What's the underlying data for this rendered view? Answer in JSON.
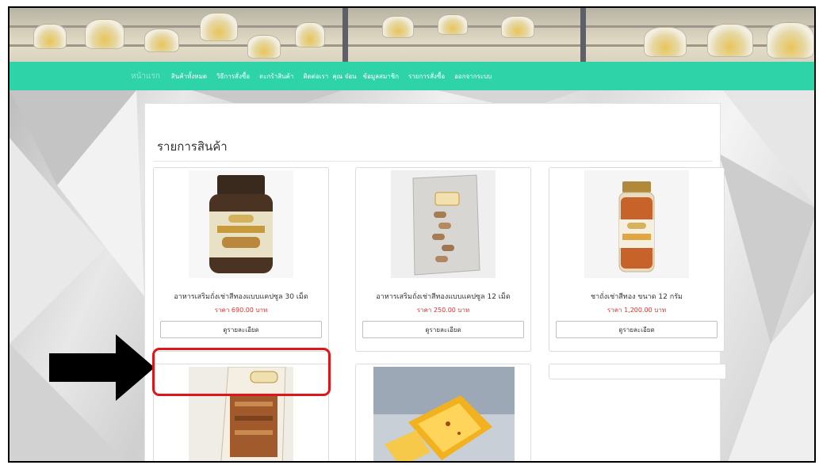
{
  "nav": {
    "items": [
      {
        "label": "หน้าแรก"
      },
      {
        "label": "สินค้าทั้งหมด"
      },
      {
        "label": "วิธีการสั่งซื้อ"
      },
      {
        "label": "ตะกร้าสินค้า"
      },
      {
        "label": "ติดต่อเรา"
      },
      {
        "label": "คุณ จ๋อน"
      },
      {
        "label": "ข้อมูลสมาชิก"
      },
      {
        "label": "รายการสั่งซื้อ"
      },
      {
        "label": "ออกจากระบบ"
      }
    ]
  },
  "main": {
    "title": "รายการสินค้า",
    "detail_button_label": "ดูรายละเอียด",
    "products": [
      {
        "name": "อาหารเสริมถั่งเช่าสีทองแบบแคปซูล 30 เม็ด",
        "price": "ราคา 690.00 บาท"
      },
      {
        "name": "อาหารเสริมถั่งเช่าสีทองแบบแคปซูล 12 เม็ด",
        "price": "ราคา 250.00 บาท"
      },
      {
        "name": "ชาถั่งเช่าสีทอง ขนาด 12 กรัม",
        "price": "ราคา 1,200.00 บาท"
      }
    ]
  },
  "colors": {
    "nav_bg": "#2ed3a8",
    "price": "#e0302f",
    "annotation_box": "#e0151a",
    "annotation_arrow": "#000000"
  },
  "icons": {
    "annotation_arrow": "right-arrow-icon"
  }
}
